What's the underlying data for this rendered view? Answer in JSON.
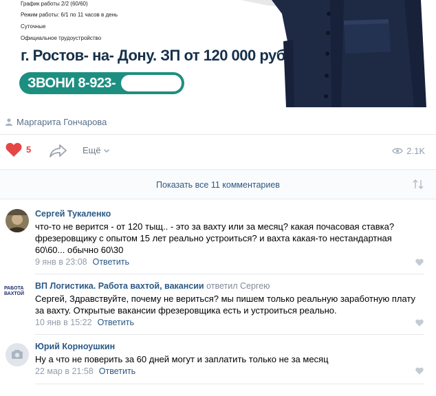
{
  "banner": {
    "schedule": "График работы 2/2 (60/60)",
    "mode": "Режим работы: 6/1 по 11 часов в день",
    "daily": "Суточные",
    "official": "Официальное трудоустройство",
    "headline": "г. Ростов- на- Дону. ЗП от 120 000 руб",
    "call": "ЗВОНИ 8-923-"
  },
  "post": {
    "author": "Маргарита Гончарова",
    "likes": "5",
    "more_label": "Ещё",
    "views": "2.1K"
  },
  "comments_header": {
    "show_all": "Показать все 11 комментариев"
  },
  "comments": [
    {
      "author": "Сергей Тукаленко",
      "replied": "",
      "text": "что-то не верится - от 120 тыщ.. - это за вахту или за месяц? какая почасовая ставка? фрезеровщику с опытом 15 лет реально устроиться? и вахта какая-то нестандартная 60\\60... обычно 60\\30",
      "date": "9 янв в 23:08",
      "reply": "Ответить"
    },
    {
      "author": "ВП Логистика. Работа вахтой, вакансии",
      "replied": "ответил Сергею",
      "text": "Сергей, Здравствуйте, почему не вериться? мы пишем только реальную заработную плату за вахту. Открытые вакансии фрезеровщика есть и устроиться реально.",
      "date": "10 янв в 15:22",
      "reply": "Ответить",
      "logo_text": "РАБОТА ВАХТОЙ"
    },
    {
      "author": "Юрий Корноушкин",
      "replied": "",
      "text": "Ну а что не поверить за 60 дней могут и заплатить только не за месяц",
      "date": "22 мар в 21:58",
      "reply": "Ответить"
    }
  ],
  "colors": {
    "link": "#2a5885",
    "like": "#e64646",
    "muted": "#939cab",
    "banner_green": "#1d8f80",
    "jacket": "#1e2a44"
  },
  "icons": [
    "user-icon",
    "heart-icon",
    "share-icon",
    "chevron-down-icon",
    "eye-icon",
    "sort-icon",
    "camera-icon"
  ]
}
